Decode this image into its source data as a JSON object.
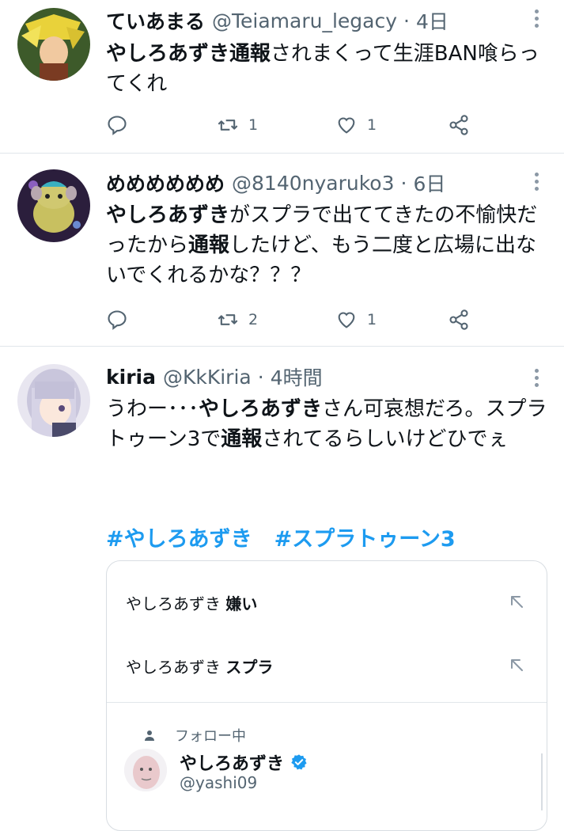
{
  "tweets": [
    {
      "name": "ていあまる",
      "handle": "@Teiamaru_legacy",
      "time": "4日",
      "text": [
        "やしろあずき",
        "通報",
        "されまくって生涯BAN喰らってくれ"
      ],
      "replies": "",
      "retweets": "1",
      "likes": "1"
    },
    {
      "name": "めめめめめめ",
      "handle": "@8140nyaruko3",
      "time": "6日",
      "text": [
        "やしろあずき",
        "がスプラで出ててきたの不愉快だったから",
        "通報",
        "したけど、もう二度と広場に出ないでくれるかな？？？"
      ],
      "replies": "",
      "retweets": "2",
      "likes": "1"
    },
    {
      "name": "kiria",
      "handle": "@KkKiria",
      "time": "4時間",
      "text": [
        "うわー･･･",
        "やしろあずき",
        "さん可哀想だろ。スプラトゥーン3で",
        "通報",
        "されてるらしいけどひでぇ"
      ],
      "hashtags": [
        "#やしろあずき",
        "#スプラトゥーン3"
      ]
    }
  ],
  "search_card": {
    "suggestions": [
      {
        "base": "やしろあずき ",
        "bold": "嫌い"
      },
      {
        "base": "やしろあずき ",
        "bold": "スプラ"
      }
    ],
    "following_label": "フォロー中",
    "user": {
      "name": "やしろあずき",
      "handle": "@yashi09"
    }
  },
  "icons": [
    "more-icon",
    "reply-icon",
    "retweet-icon",
    "like-icon",
    "share-icon",
    "arrow-up-left-icon",
    "person-icon",
    "verified-badge-icon"
  ],
  "colors": {
    "accent": "#1d9bf0",
    "secondary": "#536471",
    "text": "#0f1419"
  }
}
